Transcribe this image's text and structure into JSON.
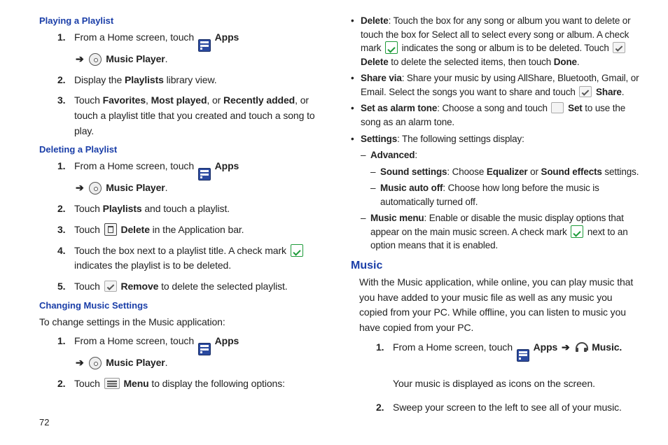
{
  "page_number": "72",
  "left": {
    "h1": "Playing a Playlist",
    "s1": {
      "n1": "1.",
      "t1a": "From a Home screen, touch",
      "apps": "Apps",
      "arrow": "➔",
      "mp": "Music Player",
      "dot": ".",
      "n2": "2.",
      "t2a": "Display the",
      "t2b": "Playlists",
      "t2c": "library view.",
      "n3": "3.",
      "t3a": "Touch",
      "t3b": "Favorites",
      "t3c": ",",
      "t3d": "Most played",
      "t3e": ", or",
      "t3f": "Recently added",
      "t3g": ", or touch a playlist title that you created and touch a song to play."
    },
    "h2": "Deleting a Playlist",
    "s2": {
      "n1": "1.",
      "t1a": "From a Home screen, touch",
      "apps": "Apps",
      "arrow": "➔",
      "mp": "Music Player",
      "dot": ".",
      "n2": "2.",
      "t2a": "Touch",
      "t2b": "Playlists",
      "t2c": "and touch a playlist.",
      "n3": "3.",
      "t3a": "Touch",
      "t3b": "Delete",
      "t3c": "in the Application bar.",
      "n4": "4.",
      "t4a": "Touch the box next to a playlist title. A check mark",
      "t4b": "indicates the playlist is to be deleted.",
      "n5": "5.",
      "t5a": "Touch",
      "t5b": "Remove",
      "t5c": "to delete the selected playlist."
    },
    "h3": "Changing Music Settings",
    "intro": "To change settings in the Music application:",
    "s3": {
      "n1": "1.",
      "t1a": "From a Home screen, touch",
      "apps": "Apps",
      "arrow": "➔",
      "mp": "Music Player",
      "dot": ".",
      "n2": "2.",
      "t2a": "Touch",
      "t2b": "Menu",
      "t2c": "to display the following options:"
    }
  },
  "right": {
    "b_delete_label": "Delete",
    "b_delete_a": ": Touch the box for any song or album you want to delete or touch the box for Select all to select every song or album. A check mark",
    "b_delete_b": "indicates the song or album is to be deleted. Touch",
    "b_delete_c": "Delete",
    "b_delete_d": "to delete the selected items, then touch",
    "b_delete_e": "Done",
    "b_delete_f": ".",
    "b_share_label": "Share via",
    "b_share_a": ": Share your music by using AllShare, Bluetooth, Gmail, or Email. Select the songs you want to share and touch",
    "b_share_b": "Share",
    "b_share_c": ".",
    "b_alarm_label": "Set as alarm tone",
    "b_alarm_a": ": Choose a song and touch",
    "b_alarm_b": "Set",
    "b_alarm_c": "to use the song as an alarm tone.",
    "b_settings_label": "Settings",
    "b_settings_a": ": The following settings display:",
    "adv_label": "Advanced",
    "adv_colon": ":",
    "ss_label": "Sound settings",
    "ss_a": ": Choose",
    "ss_b": "Equalizer",
    "ss_c": "or",
    "ss_d": "Sound effects",
    "ss_e": "settings.",
    "mao_label": "Music auto off",
    "mao_a": ": Choose how long before the music is automatically turned off.",
    "mm_label": "Music menu",
    "mm_a": ": Enable or disable the music display options that appear on the main music screen. A check mark",
    "mm_b": "next to an option means that it is enabled.",
    "section_title": "Music",
    "music_intro": "With the Music application, while online, you can play music that you have added to your music file as well as any music you copied from your PC. While offline, you can listen to music you have copied from your PC.",
    "ms": {
      "n1": "1.",
      "t1a": "From a Home screen, touch",
      "apps": "Apps",
      "arrow": "➔",
      "music": "Music.",
      "t1b": "Your music is displayed as icons on the screen.",
      "n2": "2.",
      "t2a": "Sweep your screen to the left to see all of your music."
    }
  }
}
